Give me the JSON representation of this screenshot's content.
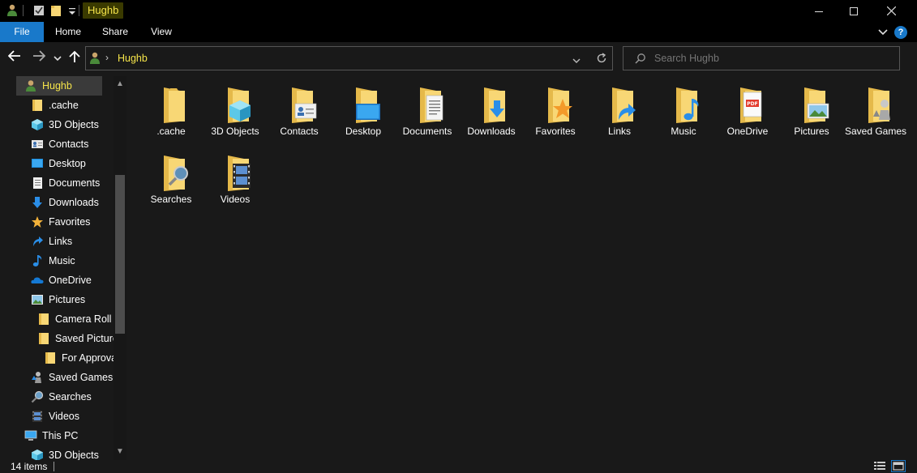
{
  "window": {
    "title": "Hughb",
    "minimize": "—",
    "maximize": "☐",
    "close": "✕"
  },
  "ribbon": {
    "tabs": [
      "File",
      "Home",
      "Share",
      "View"
    ],
    "help": "?"
  },
  "address": {
    "path": "Hughb"
  },
  "search": {
    "placeholder": "Search Hughb"
  },
  "nav_pane": {
    "items": [
      {
        "label": "Hughb",
        "icon": "user-icon",
        "selected": true
      },
      {
        "label": ".cache",
        "icon": "folder-icon"
      },
      {
        "label": "3D Objects",
        "icon": "3d-objects-icon"
      },
      {
        "label": "Contacts",
        "icon": "contacts-icon"
      },
      {
        "label": "Desktop",
        "icon": "desktop-icon"
      },
      {
        "label": "Documents",
        "icon": "documents-icon"
      },
      {
        "label": "Downloads",
        "icon": "downloads-icon"
      },
      {
        "label": "Favorites",
        "icon": "favorites-icon"
      },
      {
        "label": "Links",
        "icon": "links-icon"
      },
      {
        "label": "Music",
        "icon": "music-icon"
      },
      {
        "label": "OneDrive",
        "icon": "onedrive-icon"
      },
      {
        "label": "Pictures",
        "icon": "pictures-icon"
      },
      {
        "label": "Camera Roll",
        "icon": "folder-icon"
      },
      {
        "label": "Saved Picture",
        "icon": "folder-icon"
      },
      {
        "label": "For Approva",
        "icon": "folder-icon"
      },
      {
        "label": "Saved Games",
        "icon": "saved-games-icon"
      },
      {
        "label": "Searches",
        "icon": "searches-icon"
      },
      {
        "label": "Videos",
        "icon": "videos-icon"
      },
      {
        "label": "This PC",
        "icon": "this-pc-icon"
      },
      {
        "label": "3D Objects",
        "icon": "3d-objects-icon"
      }
    ]
  },
  "content": {
    "items": [
      {
        "label": ".cache",
        "icon": "folder-icon"
      },
      {
        "label": "3D Objects",
        "icon": "3d-objects-icon"
      },
      {
        "label": "Contacts",
        "icon": "contacts-icon"
      },
      {
        "label": "Desktop",
        "icon": "desktop-icon"
      },
      {
        "label": "Documents",
        "icon": "documents-icon"
      },
      {
        "label": "Downloads",
        "icon": "downloads-icon"
      },
      {
        "label": "Favorites",
        "icon": "favorites-icon"
      },
      {
        "label": "Links",
        "icon": "links-icon"
      },
      {
        "label": "Music",
        "icon": "music-icon"
      },
      {
        "label": "OneDrive",
        "icon": "onedrive-icon"
      },
      {
        "label": "Pictures",
        "icon": "pictures-icon"
      },
      {
        "label": "Saved Games",
        "icon": "saved-games-icon"
      },
      {
        "label": "Searches",
        "icon": "searches-icon"
      },
      {
        "label": "Videos",
        "icon": "videos-icon"
      }
    ]
  },
  "status": {
    "count": "14 items"
  },
  "colors": {
    "background": "#191919",
    "chrome": "#000000",
    "accent": "#1979ca",
    "folder": "#f8d775",
    "title_highlight": "#f5e44a"
  }
}
